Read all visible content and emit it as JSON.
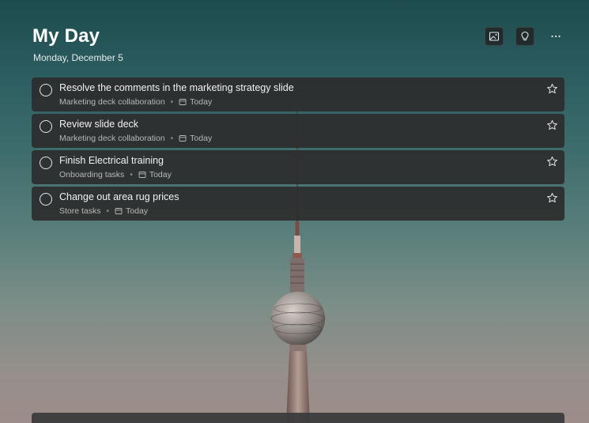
{
  "header": {
    "title": "My Day",
    "date": "Monday, December 5"
  },
  "toolbar": {
    "buttons": [
      {
        "icon": "background-image-icon"
      },
      {
        "icon": "lightbulb-icon"
      },
      {
        "icon": "more-icon"
      }
    ]
  },
  "tasks": [
    {
      "title": "Resolve the comments in the marketing strategy slide",
      "list": "Marketing deck collaboration",
      "due": "Today"
    },
    {
      "title": "Review slide deck",
      "list": "Marketing deck collaboration",
      "due": "Today"
    },
    {
      "title": "Finish Electrical training",
      "list": "Onboarding tasks",
      "due": "Today"
    },
    {
      "title": "Change out area rug prices",
      "list": "Store tasks",
      "due": "Today"
    }
  ],
  "colors": {
    "task_bg": "#2c2c2c",
    "text_primary": "#f2f2f2",
    "text_secondary": "#b8b8b8"
  }
}
